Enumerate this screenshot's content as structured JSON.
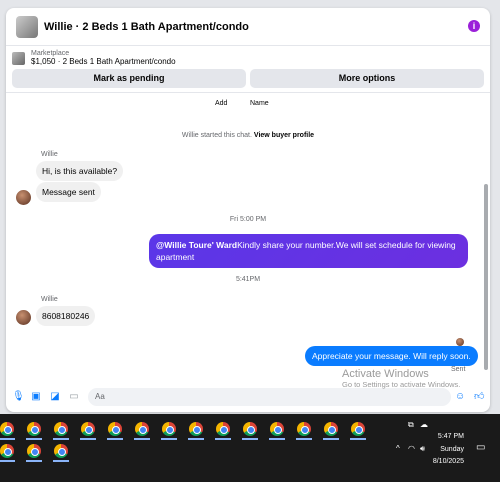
{
  "header": {
    "title": "Willie · 2 Beds 1 Bath Apartment/condo",
    "info_icon": "info-icon"
  },
  "listing": {
    "source": "Marketplace",
    "description": "$1,050 · 2 Beds 1 Bath Apartment/condo",
    "mark_pending": "Mark as pending",
    "more_options": "More options"
  },
  "top_labels": {
    "add": "Add",
    "name": "Name"
  },
  "system": {
    "started": "Willie started this chat.",
    "view_profile": "View buyer profile"
  },
  "messages": {
    "sender1": "Willie",
    "msg1": "Hi, is this available?",
    "msg2": "Message sent",
    "time1": "Fri 5:00 PM",
    "out1_mention": "@Willie Toure' Ward",
    "out1_text": "Kindly share your number.We will set schedule for viewing apartment",
    "time2": "5:41PM",
    "sender2": "Willie",
    "msg3": "8608180246",
    "out2": "Appreciate your message. Will reply soon.",
    "sent_status": "Sent"
  },
  "composer": {
    "placeholder": "Aa"
  },
  "watermark": {
    "line1": "Activate Windows",
    "line2": "Go to Settings to activate Windows."
  },
  "tray": {
    "time": "5:47 PM",
    "day": "Sunday",
    "date": "8/10/2025"
  },
  "colors": {
    "accent": "#0a7cff",
    "purple": "#6c2fe0",
    "info": "#9b20d9"
  }
}
